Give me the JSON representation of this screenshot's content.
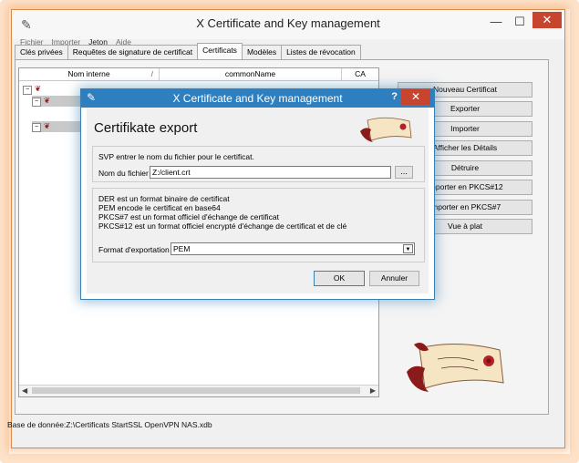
{
  "window": {
    "title": "X Certificate and Key management"
  },
  "menu": [
    "Fichier",
    "Importer",
    "Jeton",
    "Aide"
  ],
  "tabs": [
    "Clés privées",
    "Requêtes de signature de certificat",
    "Certificats",
    "Modèles",
    "Listes de révocation"
  ],
  "table": {
    "columns": [
      "Nom interne",
      "/",
      "commonName",
      "CA"
    ]
  },
  "sidebar": {
    "buttons": [
      "Nouveau Certificat",
      "Exporter",
      "Importer",
      "Afficher les Détails",
      "Détruire",
      "Importer en PKCS#12",
      "Importer en PKCS#7",
      "Vue à plat"
    ]
  },
  "status": {
    "text": "Base de donnée:Z:\\Certificats StartSSL OpenVPN NAS.xdb"
  },
  "dialog": {
    "title": "X Certificate and Key management",
    "heading": "Certifikate export",
    "filename_prompt": "SVP entrer le nom du fichier pour le certificat.",
    "filename_label": "Nom du fichier",
    "filename_value": "Z:/client.crt",
    "browse_label": "...",
    "info_lines": [
      "DER est un format binaire de certificat",
      "PEM encode le certificat en base64",
      "PKCS#7 est un format officiel d'échange de certificat",
      "PKCS#12 est un format officiel encrypté d'échange de certificat et de clé"
    ],
    "format_label": "Format d'exportation",
    "format_value": "PEM",
    "ok_label": "OK",
    "cancel_label": "Annuler"
  },
  "colors": {
    "accent": "#2d7fc0",
    "close": "#c7452f",
    "glow": "#f6aa6e"
  }
}
